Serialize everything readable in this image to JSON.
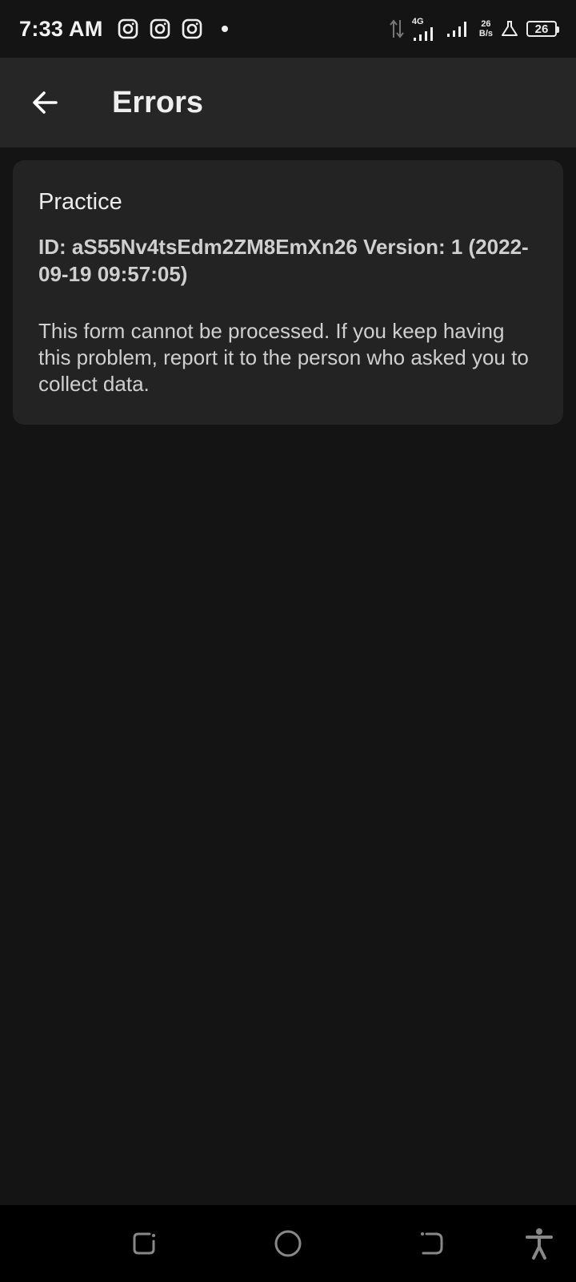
{
  "status_bar": {
    "time": "7:33 AM",
    "network_type": "4G",
    "data_speed_value": "26",
    "data_speed_unit": "B/s",
    "battery_level": "26",
    "icons": [
      "instagram-icon",
      "instagram-icon",
      "instagram-icon",
      "notification-dot",
      "data-transfer-icon",
      "signal-icon",
      "signal-icon",
      "beaker-icon",
      "battery-icon"
    ]
  },
  "app_bar": {
    "back_icon": "arrow-left-icon",
    "title": "Errors"
  },
  "error_card": {
    "form_name": "Practice",
    "id_line": "ID: aS55Nv4tsEdm2ZM8EmXn26 Version: 1 (2022-09-19 09:57:05)",
    "message": "This form cannot be processed. If you keep having this problem, report it to the person who asked you to collect data."
  },
  "nav_bar": {
    "icons": [
      "recents-icon",
      "home-icon",
      "back-icon",
      "accessibility-icon"
    ]
  },
  "colors": {
    "background": "#141414",
    "app_bar": "#262626",
    "card": "#232323",
    "nav_bar": "#000000"
  }
}
